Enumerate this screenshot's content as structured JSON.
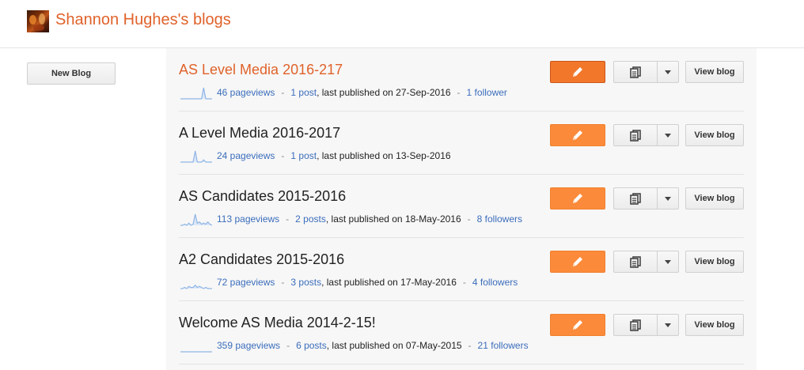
{
  "header": {
    "title": "Shannon Hughes's blogs"
  },
  "sidebar": {
    "new_blog_label": "New Blog"
  },
  "actions": {
    "view_blog_label": "View blog",
    "edit_icon": "pencil-icon",
    "posts_icon": "posts-icon",
    "dropdown_icon": "chevron-down-icon"
  },
  "colors": {
    "accent": "#e0622a",
    "edit_button": "#fb8a3a",
    "link": "#3b6dbb",
    "sparkline": "#8fb5e6"
  },
  "blogs": [
    {
      "title": "AS Level Media 2016-217",
      "pageviews": "46 pageviews",
      "posts": "1 post",
      "published": ", last published on 27-Sep-2016",
      "followers": "1 follower",
      "active": true,
      "spark": [
        0,
        0,
        0,
        0,
        0,
        0,
        0,
        0,
        0,
        0,
        0,
        1,
        0,
        0,
        0,
        0
      ]
    },
    {
      "title": "A Level Media 2016-2017",
      "pageviews": "24 pageviews",
      "posts": "1 post",
      "published": ", last published on 13-Sep-2016",
      "followers": "",
      "active": false,
      "spark": [
        0,
        0,
        0,
        0,
        0,
        0,
        0,
        1,
        0,
        0,
        0,
        0.2,
        0,
        0,
        0,
        0
      ]
    },
    {
      "title": "AS Candidates 2015-2016",
      "pageviews": "113 pageviews",
      "posts": "2 posts",
      "published": ", last published on 18-May-2016",
      "followers": "8 followers",
      "active": false,
      "spark": [
        0,
        0,
        0.1,
        0,
        0.2,
        0,
        0.1,
        1,
        0.2,
        0.3,
        0.1,
        0.2,
        0.1,
        0.3,
        0.1,
        0
      ]
    },
    {
      "title": "A2 Candidates 2015-2016",
      "pageviews": "72 pageviews",
      "posts": "3 posts",
      "published": ", last published on 17-May-2016",
      "followers": "4 followers",
      "active": false,
      "spark": [
        0,
        0,
        0.1,
        0,
        0.2,
        0.1,
        0.1,
        0.3,
        0.1,
        0.2,
        0.1,
        0,
        0.1,
        0,
        0,
        0
      ]
    },
    {
      "title": "Welcome AS Media 2014-2-15!",
      "pageviews": "359 pageviews",
      "posts": "6 posts",
      "published": ", last published on 07-May-2015",
      "followers": "21 followers",
      "active": false,
      "spark": [
        0,
        0,
        0,
        0,
        0,
        0,
        0,
        0,
        0,
        0,
        0,
        0,
        0,
        0,
        0,
        0
      ]
    }
  ]
}
